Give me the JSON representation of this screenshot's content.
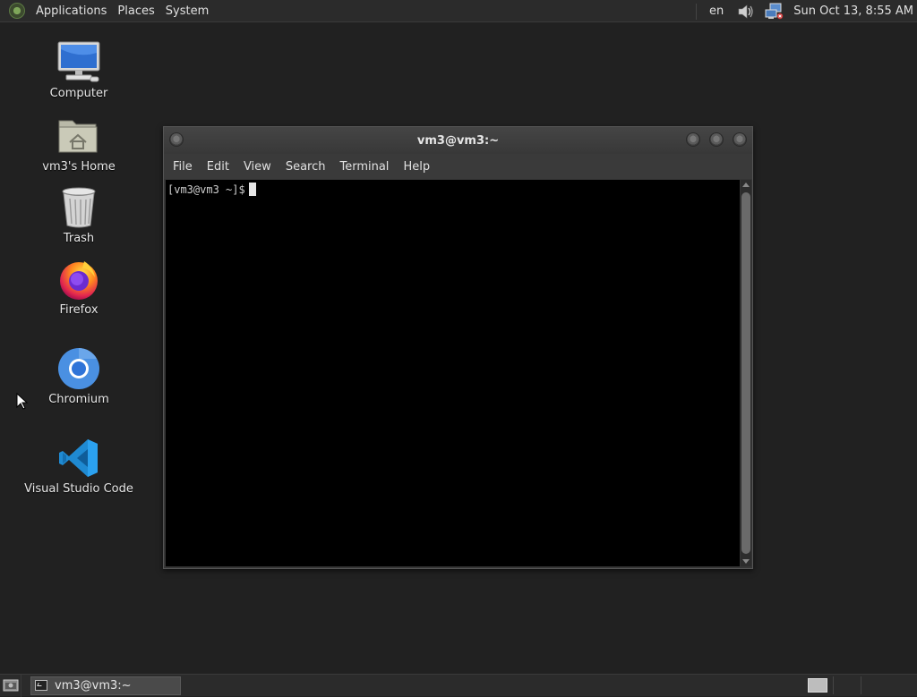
{
  "top_panel": {
    "menus": [
      "Applications",
      "Places",
      "System"
    ],
    "tray": {
      "language": "en",
      "volume_icon": "volume-icon",
      "network_icon": "network-icon",
      "clock": "Sun Oct 13,  8:55 AM"
    }
  },
  "desktop": {
    "icons": [
      {
        "label": "Computer",
        "icon": "computer-icon"
      },
      {
        "label": "vm3's Home",
        "icon": "home-folder-icon"
      },
      {
        "label": "Trash",
        "icon": "trash-icon"
      },
      {
        "label": "Firefox",
        "icon": "firefox-icon"
      },
      {
        "label": "Chromium",
        "icon": "chromium-icon"
      },
      {
        "label": "Visual Studio Code",
        "icon": "vscode-icon"
      }
    ]
  },
  "terminal": {
    "title": "vm3@vm3:~",
    "menu": [
      "File",
      "Edit",
      "View",
      "Search",
      "Terminal",
      "Help"
    ],
    "prompt": "[vm3@vm3 ~]$"
  },
  "bottom_panel": {
    "task_label": "vm3@vm3:~"
  }
}
